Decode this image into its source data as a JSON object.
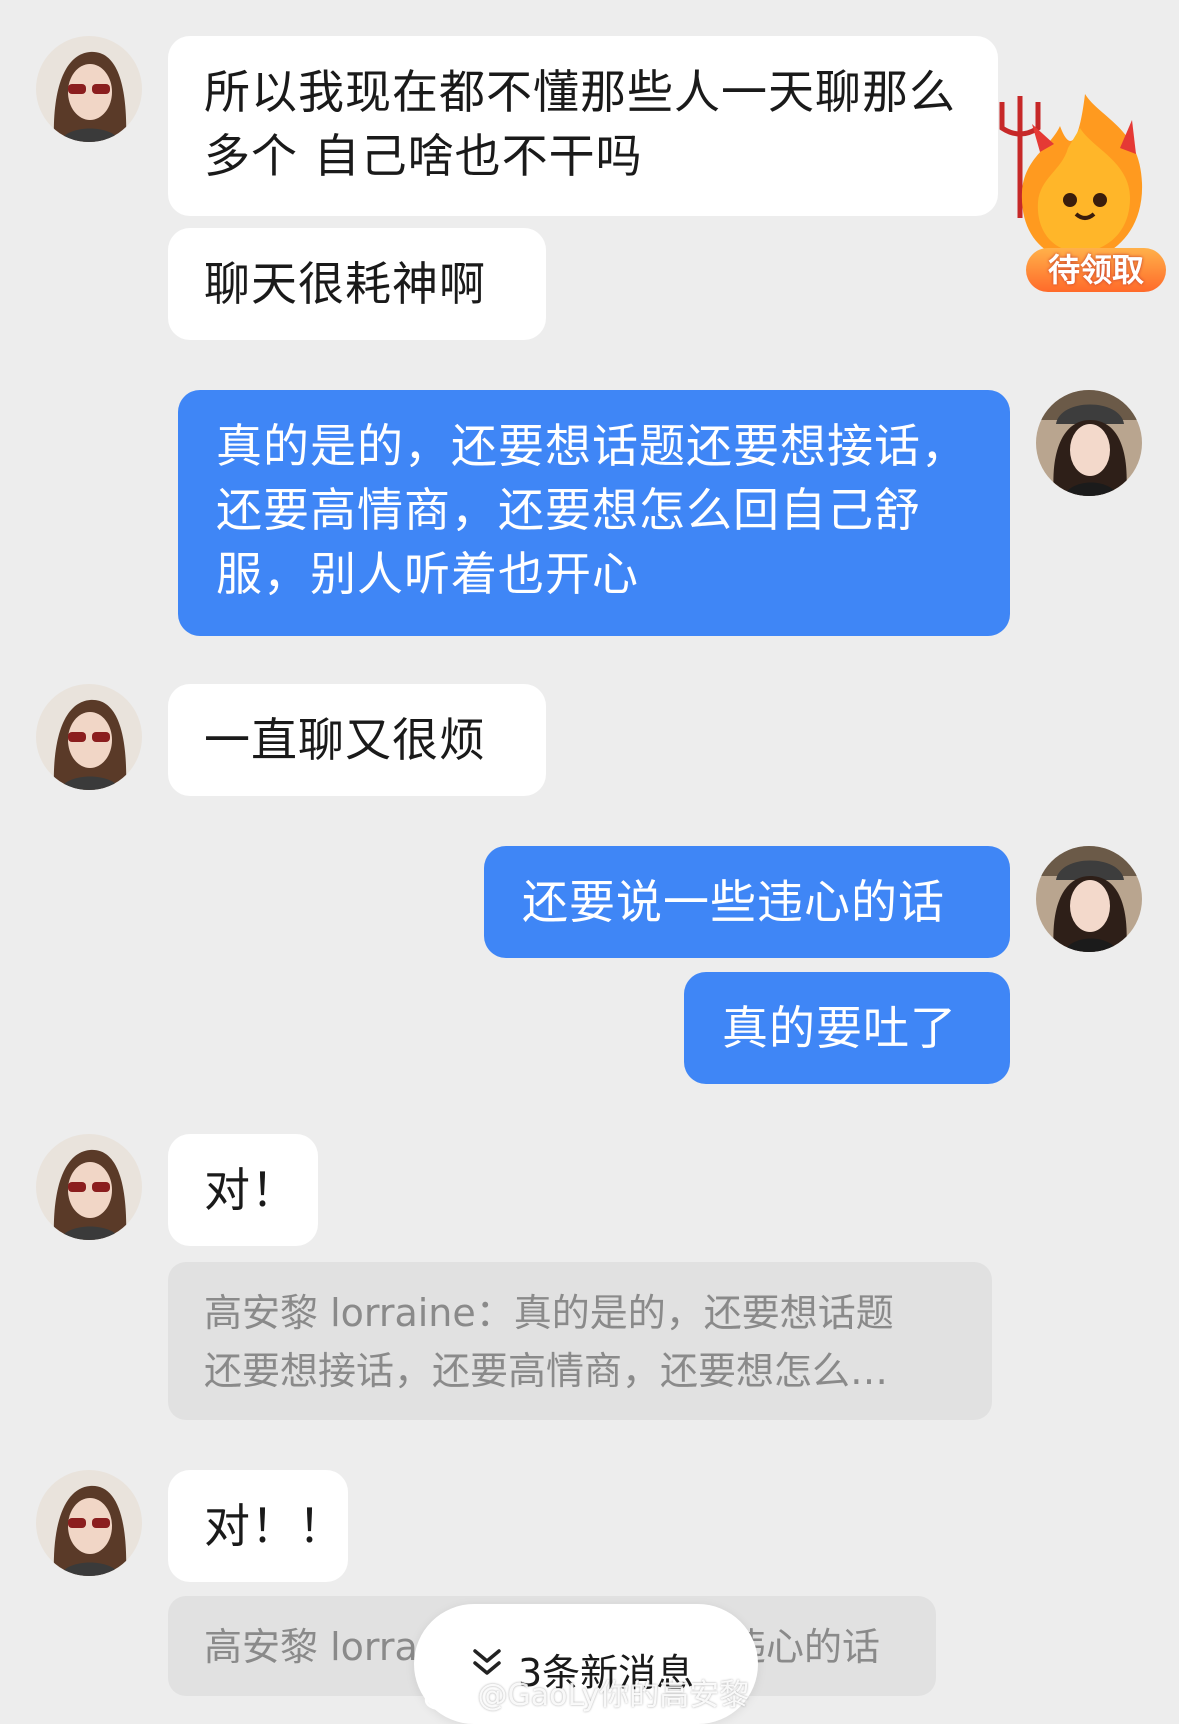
{
  "messages": {
    "m1": "所以我现在都不懂那些人一天聊那么多个 自己啥也不干吗",
    "m2": "聊天很耗神啊",
    "m3": "真的是的，还要想话题还要想接话，还要高情商，还要想怎么回自己舒服，别人听着也开心",
    "m4": "一直聊又很烦",
    "m5": "还要说一些违心的话",
    "m6": "真的要吐了",
    "m7": "对！",
    "q1_line1": "高安黎 lorraine：真的是的，还要想话题",
    "q1_line2": "还要想接话，还要高情商，还要想怎么…",
    "m8": "对！！",
    "q2_left": "高安黎 lorra",
    "q2_right": "违心的话"
  },
  "sticker": {
    "label": "待领取",
    "icon": "devil-flame-mascot-icon"
  },
  "new_messages": {
    "label": "3条新消息",
    "icon": "double-chevron-down-icon"
  },
  "watermark": {
    "text": "@GaoLy你的高安黎",
    "icon": "weibo-icon"
  },
  "colors": {
    "background": "#ededed",
    "incoming_bubble": "#ffffff",
    "outgoing_bubble": "#3f86f6",
    "quote_bg": "#e1e1e1",
    "quote_text": "#8a8a8a"
  }
}
